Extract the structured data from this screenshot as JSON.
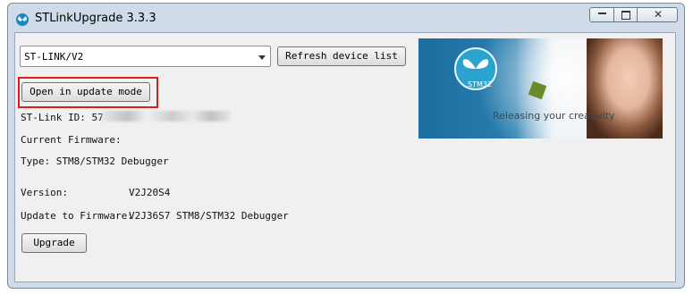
{
  "window": {
    "title": "STLinkUpgrade 3.3.3"
  },
  "device_select": {
    "selected": "ST-LINK/V2"
  },
  "buttons": {
    "refresh": "Refresh device list",
    "open_update": "Open in update mode",
    "upgrade": "Upgrade"
  },
  "info": {
    "stlink_id_label": "ST-Link ID: 57",
    "current_firmware_label": "Current Firmware:",
    "type_label": "Type: STM8/STM32 Debugger",
    "version_label": "Version:",
    "version_value": "V2J20S4",
    "update_label": "Update to Firmware:",
    "update_value": "V2J36S7 STM8/STM32 Debugger"
  },
  "banner": {
    "logo_text": "STM32",
    "tagline": "Releasing your creativity"
  },
  "colors": {
    "highlight": "#e01b1b",
    "accent": "#2aa3cf"
  }
}
